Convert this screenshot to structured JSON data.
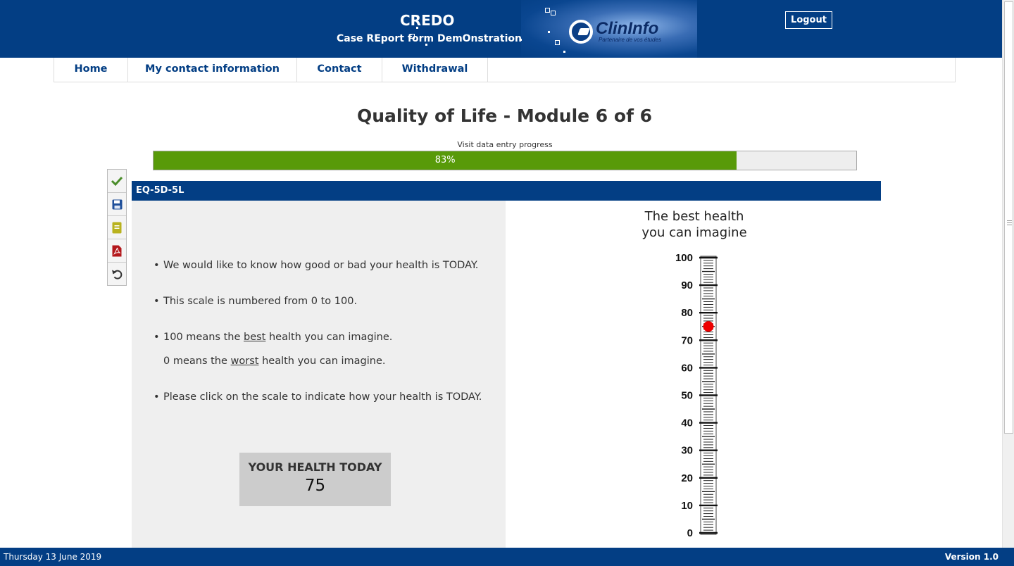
{
  "header": {
    "title": "CREDO",
    "subtitle": "Case REport form DemOnstration",
    "logo_name": "ClinInfo",
    "logo_tagline": "Partenaire de vos études",
    "logout_label": "Logout"
  },
  "nav": {
    "items": [
      {
        "label": "Home"
      },
      {
        "label": "My contact information"
      },
      {
        "label": "Contact"
      },
      {
        "label": "Withdrawal"
      }
    ]
  },
  "page": {
    "title": "Quality of Life - Module 6 of 6",
    "progress_label": "Visit data entry progress",
    "progress_text": "83%",
    "progress_value": 0.83
  },
  "toolbar": {
    "items": [
      {
        "icon": "checkmark-icon",
        "color": "#4a8d2a"
      },
      {
        "icon": "save-icon",
        "color": "#1f4f9a"
      },
      {
        "icon": "notes-icon",
        "color": "#b9b21e"
      },
      {
        "icon": "pdf-icon",
        "color": "#b3171b"
      },
      {
        "icon": "undo-icon",
        "color": "#333333"
      }
    ]
  },
  "section": {
    "title": "EQ-5D-5L",
    "instructions": {
      "line1": "We would like to know how good or bad your health is TODAY.",
      "line2": "This scale is numbered from 0 to 100.",
      "line3_pre": "100 means the ",
      "line3_u": "best",
      "line3_post": " health you can imagine.",
      "line4_pre": "0 means the ",
      "line4_u": "worst",
      "line4_post": " health you can imagine.",
      "line5": "Please click on the scale to indicate how your health is TODAY."
    },
    "health_box": {
      "label": "YOUR HEALTH TODAY",
      "value": "75"
    },
    "scale": {
      "title_line1": "The best health",
      "title_line2": "you can imagine",
      "labels": [
        "100",
        "90",
        "80",
        "70",
        "60",
        "50",
        "40",
        "30",
        "20",
        "10",
        "0"
      ],
      "selected_value": 75,
      "marker_color": "#ee0000"
    }
  },
  "footer": {
    "date": "Thursday 13 June 2019",
    "version": "Version 1.0"
  },
  "colors": {
    "brand_blue": "#033e84",
    "progress_green": "#589a09"
  }
}
